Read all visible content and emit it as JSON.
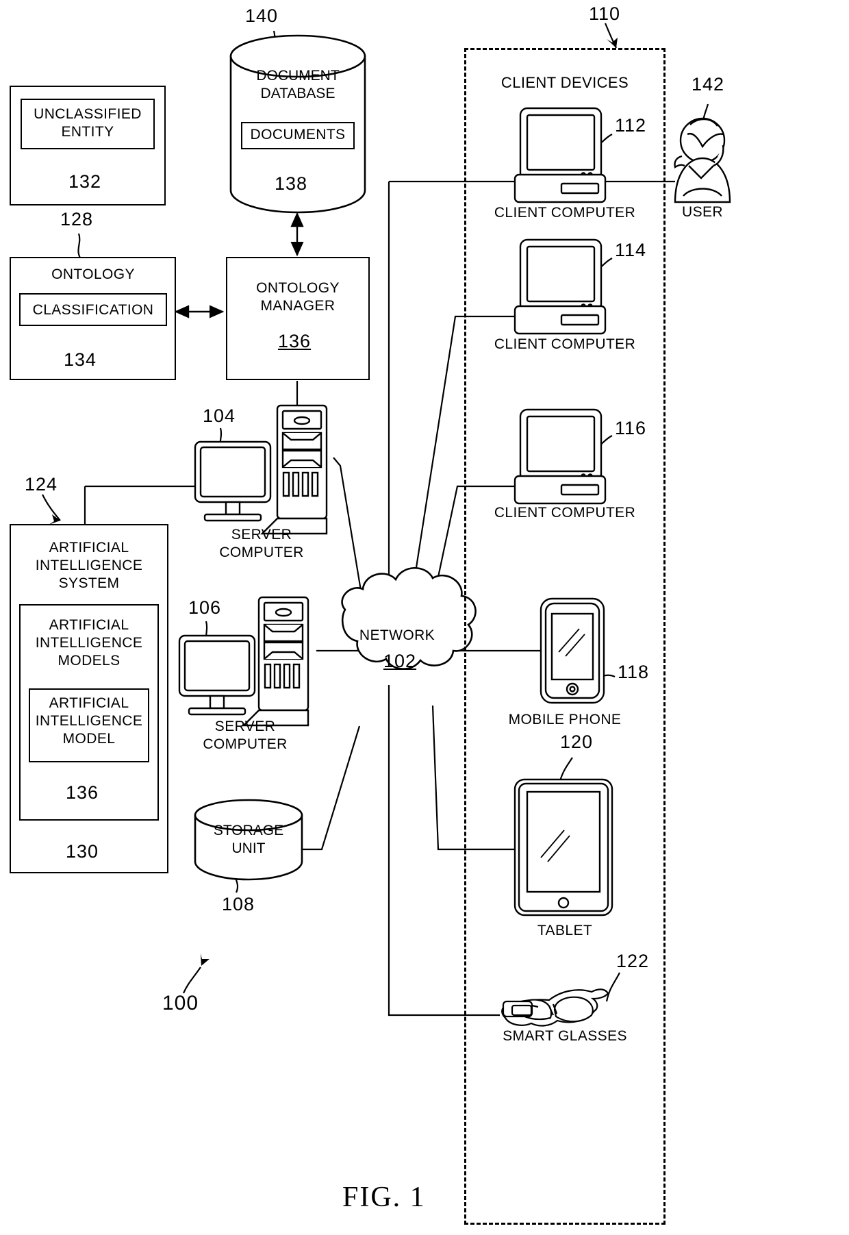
{
  "figure": {
    "caption": "FIG. 1",
    "system_ref": "100"
  },
  "blocks": {
    "unclassified_entity": {
      "label": "UNCLASSIFIED\nENTITY",
      "ref": "132"
    },
    "entity_outer": {
      "ref": "128"
    },
    "ontology": {
      "label": "ONTOLOGY",
      "ref": "128"
    },
    "classification": {
      "label": "CLASSIFICATION",
      "ref": "134"
    },
    "ontology_manager": {
      "label": "ONTOLOGY\nMANAGER",
      "ref": "136"
    },
    "document_database": {
      "label": "DOCUMENT\nDATABASE",
      "ref": "140"
    },
    "documents": {
      "label": "DOCUMENTS",
      "ref": "138"
    },
    "ai_system": {
      "label": "ARTIFICIAL\nINTELLIGENCE\nSYSTEM",
      "ref": "124"
    },
    "ai_models": {
      "label": "ARTIFICIAL\nINTELLIGENCE\nMODELS",
      "ref": "130"
    },
    "ai_model": {
      "label": "ARTIFICIAL\nINTELLIGENCE\nMODEL",
      "ref": "136"
    },
    "storage_unit": {
      "label": "STORAGE\nUNIT",
      "ref": "108"
    },
    "network": {
      "label": "NETWORK",
      "ref": "102"
    }
  },
  "servers": [
    {
      "label": "SERVER\nCOMPUTER",
      "ref": "104"
    },
    {
      "label": "SERVER\nCOMPUTER",
      "ref": "106"
    }
  ],
  "client_devices": {
    "group_label": "CLIENT DEVICES",
    "group_ref": "110",
    "items": [
      {
        "label": "CLIENT COMPUTER",
        "ref": "112",
        "icon": "desktop-computer-icon"
      },
      {
        "label": "CLIENT COMPUTER",
        "ref": "114",
        "icon": "desktop-computer-icon"
      },
      {
        "label": "CLIENT COMPUTER",
        "ref": "116",
        "icon": "desktop-computer-icon"
      },
      {
        "label": "MOBILE PHONE",
        "ref": "118",
        "icon": "mobile-phone-icon"
      },
      {
        "label": "TABLET",
        "ref": "120",
        "icon": "tablet-icon"
      },
      {
        "label": "SMART GLASSES",
        "ref": "122",
        "icon": "smart-glasses-icon"
      }
    ]
  },
  "user": {
    "label": "USER",
    "ref": "142",
    "icon": "person-icon"
  },
  "colors": {
    "line": "#000000",
    "background": "#ffffff"
  }
}
